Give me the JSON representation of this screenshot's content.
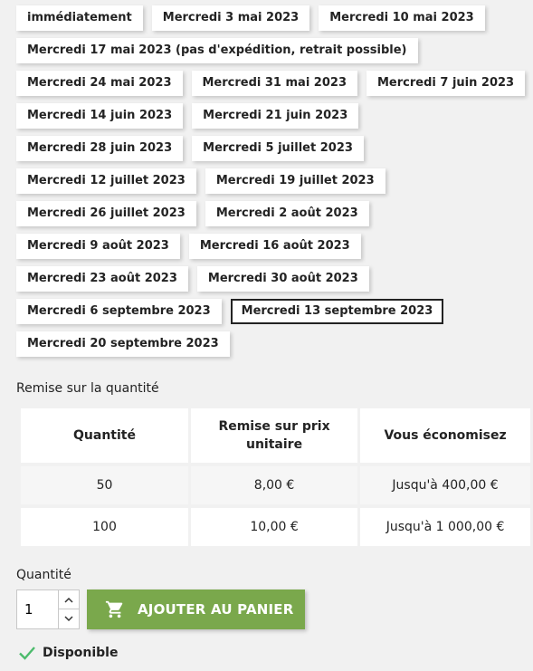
{
  "date_options": {
    "rows": [
      [
        "immédiatement",
        "Mercredi 3 mai 2023",
        "Mercredi 10 mai 2023"
      ],
      [
        "Mercredi 17 mai 2023 (pas d'expédition, retrait possible)"
      ],
      [
        "Mercredi 24 mai 2023",
        "Mercredi 31 mai 2023",
        "Mercredi 7 juin 2023"
      ],
      [
        "Mercredi 14 juin 2023",
        "Mercredi 21 juin 2023"
      ],
      [
        "Mercredi 28 juin 2023",
        "Mercredi 5 juillet 2023"
      ],
      [
        "Mercredi 12 juillet 2023",
        "Mercredi 19 juillet 2023"
      ],
      [
        "Mercredi 26 juillet 2023",
        "Mercredi 2 août 2023"
      ],
      [
        "Mercredi 9 août 2023",
        "Mercredi 16 août 2023"
      ],
      [
        "Mercredi 23 août 2023",
        "Mercredi 30 août 2023"
      ],
      [
        "Mercredi 6 septembre 2023",
        "Mercredi 13 septembre 2023"
      ],
      [
        "Mercredi 20 septembre 2023"
      ]
    ],
    "selected": "Mercredi 13 septembre 2023"
  },
  "discount": {
    "title": "Remise sur la quantité",
    "headers": [
      "Quantité",
      "Remise sur prix unitaire",
      "Vous économisez"
    ],
    "rows": [
      [
        "50",
        "8,00 €",
        "Jusqu'à 400,00 €"
      ],
      [
        "100",
        "10,00 €",
        "Jusqu'à 1 000,00 €"
      ]
    ]
  },
  "quantity": {
    "label": "Quantité",
    "value": "1"
  },
  "add_to_cart": {
    "label": "AJOUTER AU PANIER",
    "icon": "cart-icon"
  },
  "availability": {
    "label": "Disponible",
    "icon": "check-icon"
  },
  "colors": {
    "accent_green": "#7aa84c",
    "check_green": "#4cbb6c",
    "text": "#232323",
    "background": "#f1f1f1"
  }
}
